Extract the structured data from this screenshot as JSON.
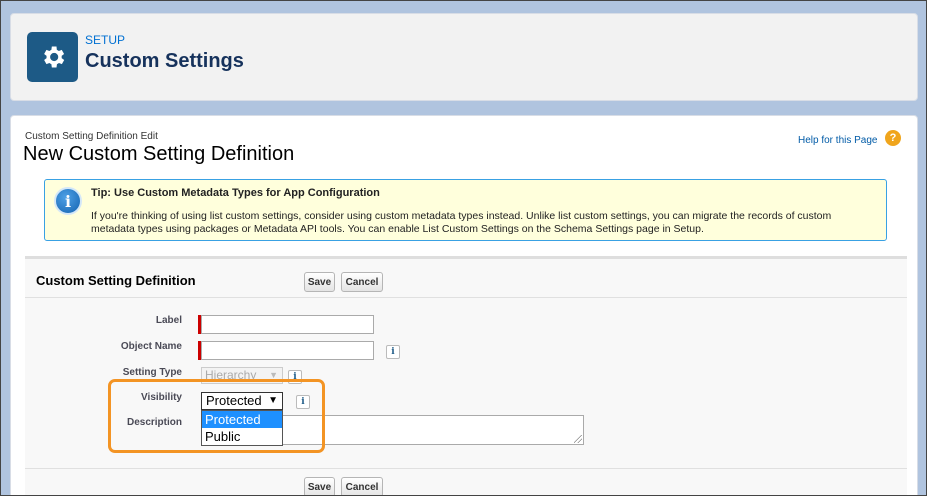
{
  "header": {
    "crumb": "SETUP",
    "title": "Custom Settings",
    "icon": "gear-icon"
  },
  "page": {
    "pre_title": "Custom Setting Definition Edit",
    "title": "New Custom Setting Definition",
    "help_link": "Help for this Page",
    "help_icon": "?"
  },
  "tip": {
    "icon": "i",
    "heading": "Tip: Use Custom Metadata Types for App Configuration",
    "body": "If you're thinking of using list custom settings, consider using custom metadata types instead. Unlike list custom settings, you can migrate the records of custom metadata types using packages or Metadata API tools. You can enable List Custom Settings on the Schema Settings page in Setup."
  },
  "definition": {
    "title": "Custom Setting Definition",
    "save_label": "Save",
    "cancel_label": "Cancel",
    "fields": {
      "label": {
        "label": "Label",
        "value": ""
      },
      "object_name": {
        "label": "Object Name",
        "value": ""
      },
      "setting_type": {
        "label": "Setting Type",
        "value": "Hierarchy"
      },
      "visibility": {
        "label": "Visibility",
        "value": "Protected",
        "options": [
          "Protected",
          "Public"
        ]
      },
      "description": {
        "label": "Description",
        "value": ""
      }
    },
    "info_glyph": "i"
  },
  "colors": {
    "highlight": "#f39424",
    "brand_icon": "#1d5a86",
    "link": "#0070d2",
    "required": "#cc0000"
  }
}
